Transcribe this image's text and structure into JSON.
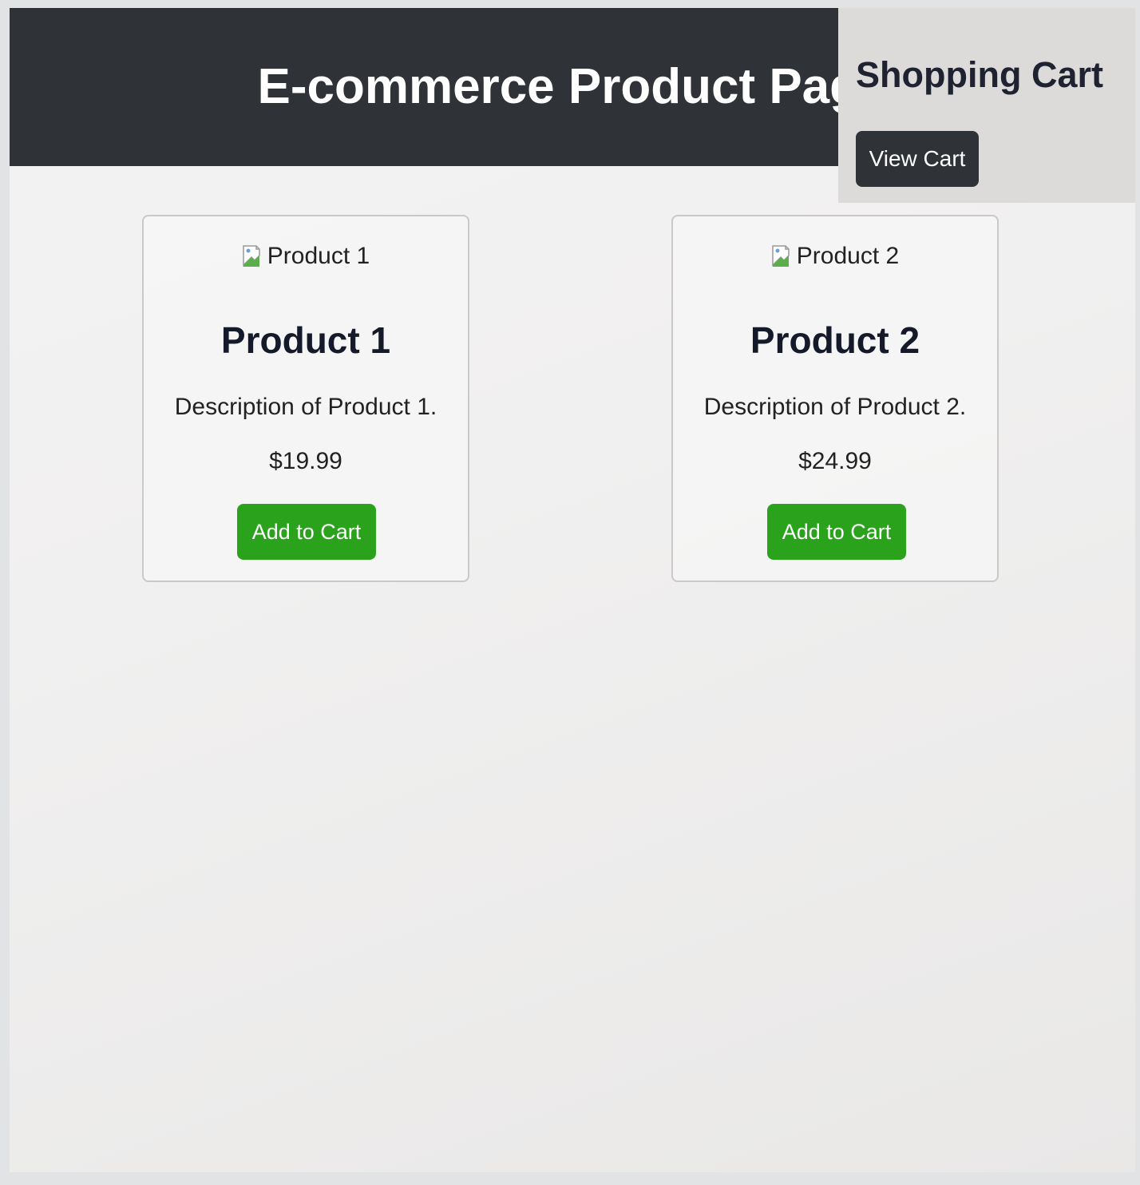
{
  "header": {
    "title": "E-commerce Product Page"
  },
  "cart": {
    "title": "Shopping Cart",
    "view_label": "View Cart"
  },
  "products": [
    {
      "image_alt": "Product 1",
      "name": "Product 1",
      "description": "Description of Product 1.",
      "price": "$19.99",
      "button_label": "Add to Cart"
    },
    {
      "image_alt": "Product 2",
      "name": "Product 2",
      "description": "Description of Product 2.",
      "price": "$24.99",
      "button_label": "Add to Cart"
    }
  ],
  "colors": {
    "header_bg": "#2f3236",
    "cart_bg": "#dcdbda",
    "add_button": "#2aa21c",
    "view_button": "#2f3236"
  },
  "icons": {
    "broken_image": "broken-image-icon"
  }
}
